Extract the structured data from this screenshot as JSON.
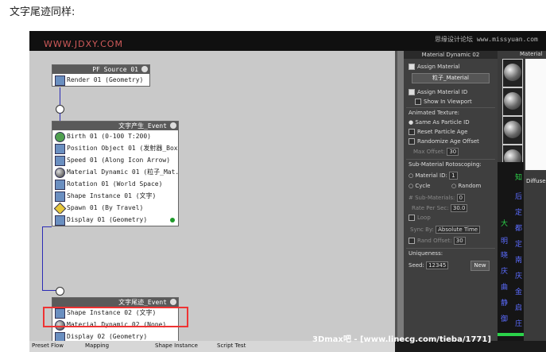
{
  "caption": "文字尾迹同样:",
  "watermark_left": "WWW.JDXY.COM",
  "watermark_right": "思缘设计论坛 www.missyuan.com",
  "events": {
    "pf_source": {
      "title": "PF Source 01",
      "ops": [
        "Render 01 (Geometry)"
      ]
    },
    "main_event": {
      "title": "文字产生_Event",
      "ops": [
        "Birth 01 (0-100 T:200)",
        "Position Object 01 (发射器_Box)",
        "Speed 01 (Along Icon Arrow)",
        "Material Dynamic 01 (粒子_Mat...",
        "Rotation 01 (World Space)",
        "Shape Instance 01 (文字)",
        "Spawn 01 (By Travel)",
        "Display 01 (Geometry)"
      ]
    },
    "trail_event": {
      "title": "文字尾迹_Event",
      "ops": [
        "Shape Instance 02 (文字)",
        "Material Dynamic 02 (None)",
        "Display 02 (Geometry)"
      ]
    }
  },
  "panel": {
    "title": "Material Dynamic 02",
    "assign_material": "Assign Material",
    "material_button": "粒子_Material",
    "assign_material_id": "Assign Material ID",
    "show_in_viewport": "Show In Viewport",
    "animated_texture": "Animated Texture:",
    "same_as_particle_id": "Same As Particle ID",
    "reset_particle_age": "Reset Particle Age",
    "randomize_age_offset": "Randomize Age Offset",
    "max_offset_label": "Max Offset:",
    "max_offset_value": "30",
    "sub_material_roto": "Sub-Material Rotoscoping:",
    "material_id_label": "Material ID:",
    "material_id_value": "1",
    "cycle": "Cycle",
    "random": "Random",
    "num_sub_materials_label": "# Sub-Materials:",
    "num_sub_materials_value": "0",
    "rate_per_sec_label": "Rate Per Sec:",
    "rate_per_sec_value": "30.0",
    "loop": "Loop",
    "sync_by_label": "Sync By:",
    "sync_by_value": "Absolute Time",
    "rand_offset_label": "Rand Offset:",
    "rand_offset_value": "30",
    "uniqueness": "Uniqueness:",
    "seed_label": "Seed:",
    "seed_value": "12345",
    "new_button": "New"
  },
  "mat_editor": {
    "title": "Material",
    "diffuse": "Diffuse",
    "green_chars": [
      "知",
      "大"
    ],
    "blue_chars": [
      "后",
      "定",
      "都",
      "定",
      "明",
      "晓",
      "南",
      "庆",
      "庆",
      "曲",
      "金",
      "静",
      "启",
      "御",
      "庄"
    ]
  },
  "bottom_bar": {
    "items": [
      "Preset Flow",
      "Mapping",
      "Shape Instance",
      "Script Test"
    ]
  },
  "site_banner": "3Dmax吧 - [www.linecg.com/tieba/1771]",
  "colors": {
    "highlight": "#e33333",
    "connector": "#2b2bb5",
    "display_dot": "#1e9a2a"
  }
}
